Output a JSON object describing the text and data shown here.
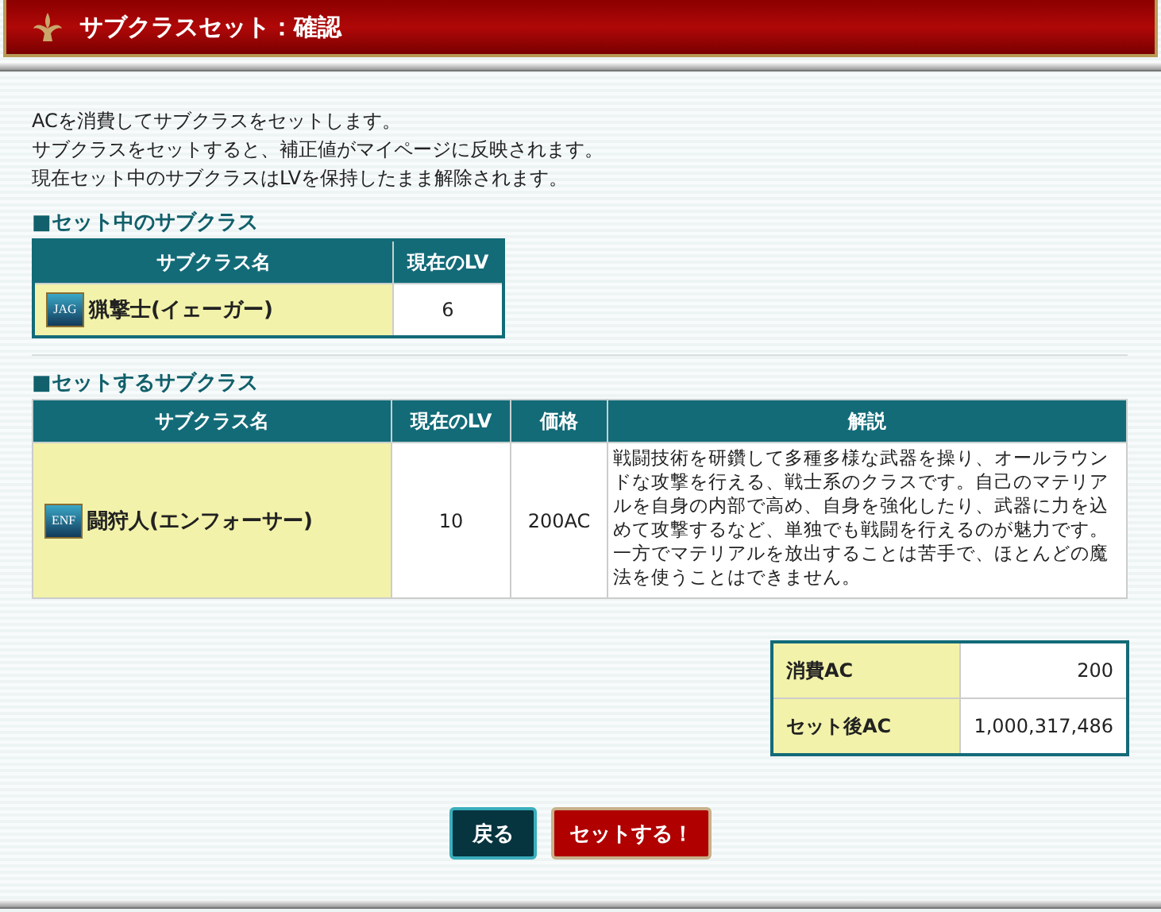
{
  "window": {
    "title": "サブクラスセット：確認"
  },
  "intro": [
    "ACを消費してサブクラスをセットします。",
    "サブクラスをセットすると、補正値がマイページに反映されます。",
    "現在セット中のサブクラスはLVを保持したまま解除されます。"
  ],
  "current": {
    "heading": "■セット中のサブクラス",
    "columns": [
      "サブクラス名",
      "現在のLV"
    ],
    "rows": [
      {
        "icon_label": "JAG",
        "name": "猟撃士(イェーガー)",
        "level": "6"
      }
    ]
  },
  "new": {
    "heading": "■セットするサブクラス",
    "columns": [
      "サブクラス名",
      "現在のLV",
      "価格",
      "解説"
    ],
    "rows": [
      {
        "icon_label": "ENF",
        "name": "闘狩人(エンフォーサー)",
        "level": "10",
        "price": "200AC",
        "description": "戦闘技術を研鑽して多種多様な武器を操り、オールラウンドな攻撃を行える、戦士系のクラスです。自己のマテリアルを自身の内部で高め、自身を強化したり、武器に力を込めて攻撃するなど、単独でも戦闘を行えるのが魅力です。一方でマテリアルを放出することは苦手で、ほとんどの魔法を使うことはできません。"
      }
    ]
  },
  "summary": [
    {
      "label": "消費AC",
      "value": "200"
    },
    {
      "label": "セット後AC",
      "value": "1,000,317,486"
    }
  ],
  "buttons": [
    {
      "kind": "back",
      "label": "戻る"
    },
    {
      "kind": "confirm",
      "label": "セットする！"
    }
  ]
}
